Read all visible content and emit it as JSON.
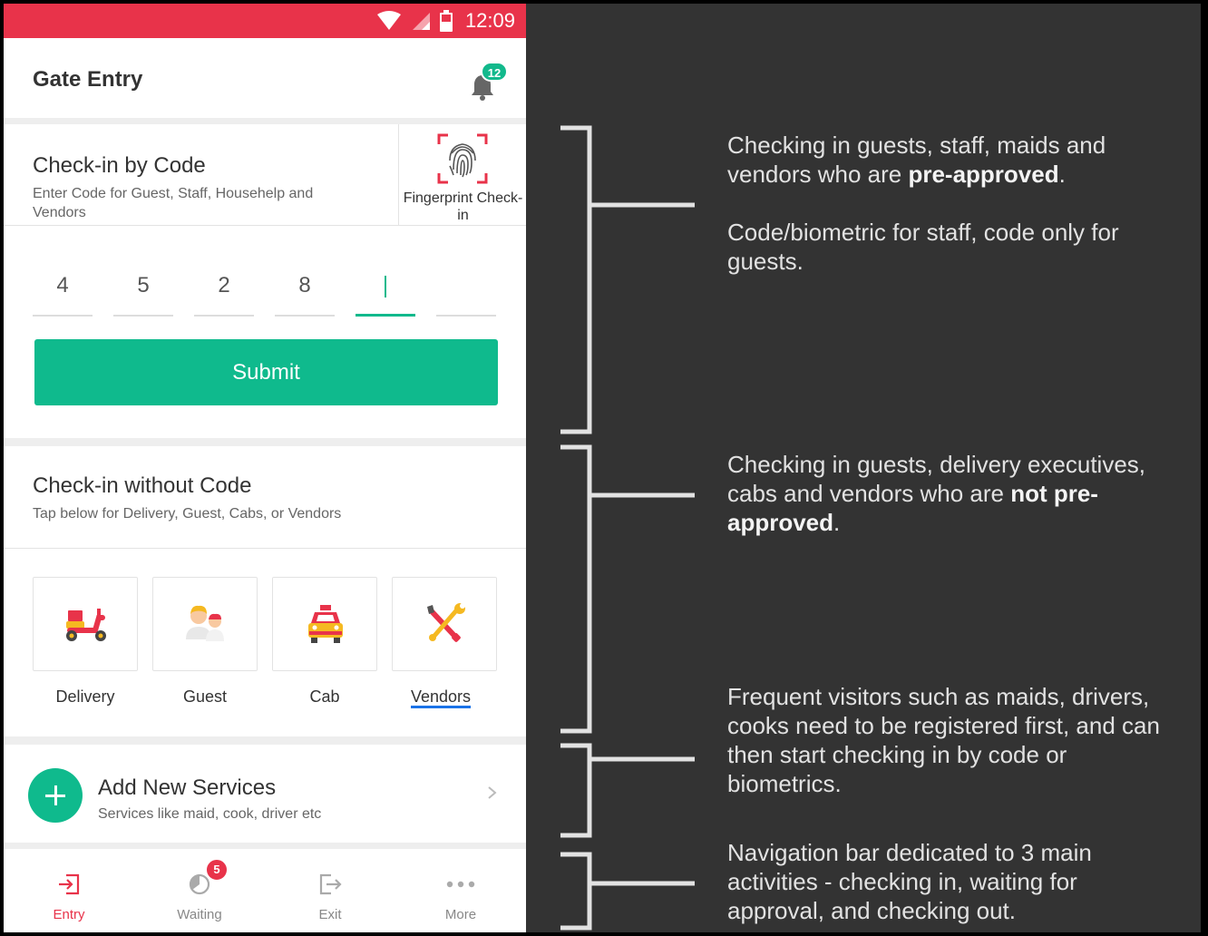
{
  "status_bar": {
    "time": "12:09"
  },
  "header": {
    "title": "Gate Entry",
    "notification_count": "12"
  },
  "code_checkin": {
    "title": "Check-in by Code",
    "subtitle": "Enter Code for Guest, Staff, Househelp and Vendors",
    "fingerprint_label": "Fingerprint Check-in",
    "digits": [
      "4",
      "5",
      "2",
      "8",
      "",
      ""
    ],
    "submit_label": "Submit"
  },
  "no_code_checkin": {
    "title": "Check-in without Code",
    "subtitle": "Tap below for Delivery, Guest, Cabs, or Vendors",
    "options": [
      {
        "label": "Delivery",
        "icon": "scooter-icon"
      },
      {
        "label": "Guest",
        "icon": "guest-icon"
      },
      {
        "label": "Cab",
        "icon": "taxi-icon"
      },
      {
        "label": "Vendors",
        "icon": "tools-icon"
      }
    ]
  },
  "add_services": {
    "title": "Add New Services",
    "subtitle": "Services like maid, cook, driver etc"
  },
  "bottom_nav": [
    {
      "label": "Entry",
      "active": true
    },
    {
      "label": "Waiting",
      "badge": "5"
    },
    {
      "label": "Exit"
    },
    {
      "label": "More"
    }
  ],
  "annotations": {
    "a1_part1": "Checking in guests, staff, maids and vendors who are ",
    "a1_bold": "pre-approved",
    "a1_part2": ".",
    "a1_para2": "Code/biometric for staff, code only for guests.",
    "a2_part1": "Checking in guests, delivery executives, cabs and vendors who are ",
    "a2_bold": "not pre-approved",
    "a2_part2": ".",
    "a3": "Frequent visitors such as maids, drivers, cooks need to be registered first, and can then start checking in by code or biometrics.",
    "a4": "Navigation bar dedicated to 3 main activities - checking in, waiting for approval, and checking out."
  },
  "colors": {
    "primary_red": "#e8334a",
    "accent_green": "#0fba8d",
    "annotation_bg": "#333333"
  }
}
